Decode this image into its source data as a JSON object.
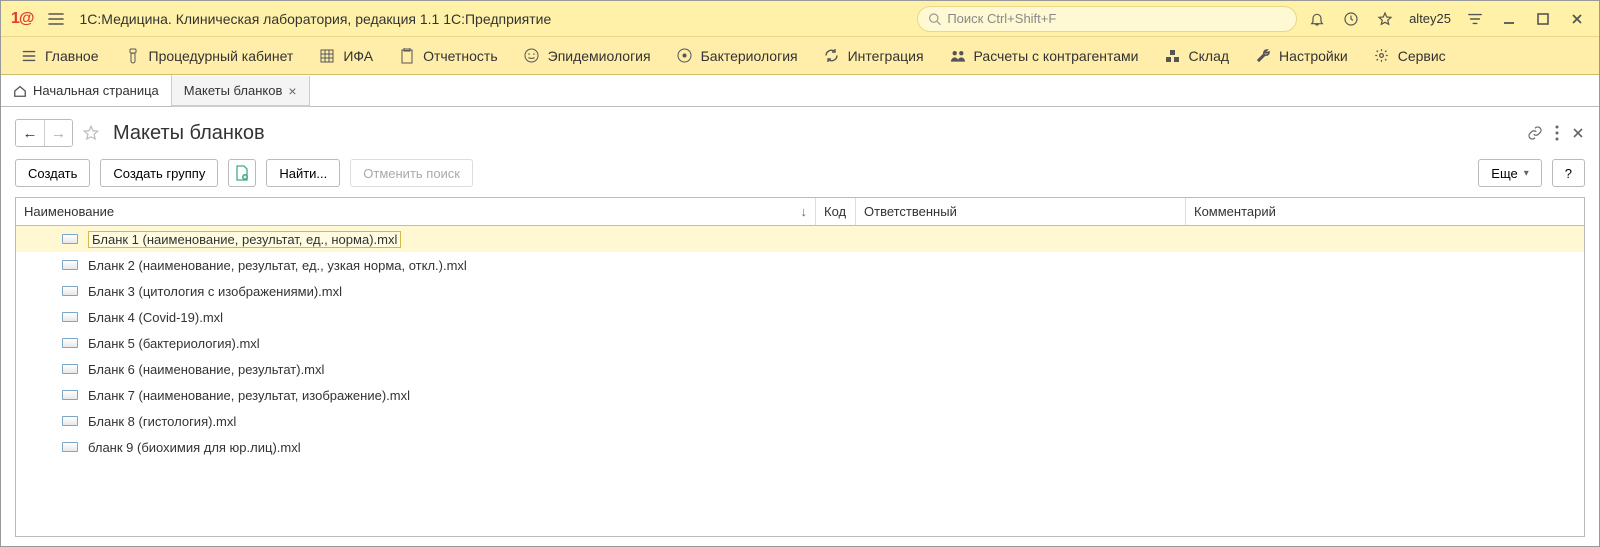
{
  "titlebar": {
    "app_title": "1С:Медицина. Клиническая лаборатория, редакция 1.1 1С:Предприятие",
    "search_placeholder": "Поиск Ctrl+Shift+F",
    "username": "altey25"
  },
  "menubar": {
    "items": [
      {
        "label": "Главное",
        "icon": "menu-icon"
      },
      {
        "label": "Процедурный кабинет",
        "icon": "flask-icon"
      },
      {
        "label": "ИФА",
        "icon": "grid-icon"
      },
      {
        "label": "Отчетность",
        "icon": "clipboard-icon"
      },
      {
        "label": "Эпидемиология",
        "icon": "smile-icon"
      },
      {
        "label": "Бактериология",
        "icon": "target-icon"
      },
      {
        "label": "Интеграция",
        "icon": "refresh-icon"
      },
      {
        "label": "Расчеты с контрагентами",
        "icon": "people-icon"
      },
      {
        "label": "Склад",
        "icon": "boxes-icon"
      },
      {
        "label": "Настройки",
        "icon": "wrench-icon"
      },
      {
        "label": "Сервис",
        "icon": "gear-icon"
      }
    ]
  },
  "tabs": [
    {
      "label": "Начальная страница",
      "closable": false
    },
    {
      "label": "Макеты бланков",
      "closable": true,
      "active": true
    }
  ],
  "page": {
    "title": "Макеты бланков"
  },
  "toolbar": {
    "create": "Создать",
    "create_group": "Создать группу",
    "find": "Найти...",
    "cancel_find": "Отменить поиск",
    "more": "Еще",
    "help": "?"
  },
  "table": {
    "columns": {
      "name": "Наименование",
      "code": "Код",
      "responsible": "Ответственный",
      "comment": "Комментарий"
    },
    "rows": [
      {
        "name": "Бланк 1 (наименование, результат, ед., норма).mxl",
        "selected": true
      },
      {
        "name": "Бланк 2 (наименование, результат, ед., узкая норма, откл.).mxl"
      },
      {
        "name": "Бланк 3 (цитология с изображениями).mxl"
      },
      {
        "name": "Бланк 4 (Covid-19).mxl"
      },
      {
        "name": "Бланк 5 (бактериология).mxl"
      },
      {
        "name": "Бланк 6 (наименование, результат).mxl"
      },
      {
        "name": "Бланк 7 (наименование, результат, изображение).mxl"
      },
      {
        "name": "Бланк 8 (гистология).mxl"
      },
      {
        "name": "бланк 9 (биохимия для юр.лиц).mxl"
      }
    ]
  }
}
